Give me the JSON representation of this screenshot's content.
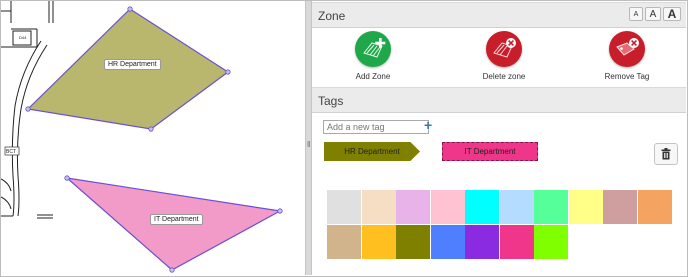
{
  "map": {
    "labels": {
      "room_code": "D44",
      "junction": "BCT"
    },
    "zones": [
      {
        "name": "HR Department",
        "color": "#b9b76e"
      },
      {
        "name": "IT Department",
        "color": "#f29ac8"
      }
    ]
  },
  "zone_section": {
    "title": "Zone",
    "font_buttons": [
      "A",
      "A",
      "A"
    ],
    "actions": [
      {
        "label": "Add Zone",
        "icon": "add-zone-icon",
        "color": "#1fa84a"
      },
      {
        "label": "Delete zone",
        "icon": "delete-zone-icon",
        "color": "#c81e2b"
      },
      {
        "label": "Remove Tag",
        "icon": "remove-tag-icon",
        "color": "#c81e2b"
      }
    ]
  },
  "tags_section": {
    "title": "Tags",
    "input_placeholder": "Add a new tag",
    "add_icon": "plus-icon",
    "tags": [
      {
        "label": "HR Department",
        "color": "#808000"
      },
      {
        "label": "IT Department",
        "color": "#f0368a"
      }
    ],
    "delete_icon": "trash-icon",
    "palette": [
      "#e0e0e0",
      "#f5dec3",
      "#e8b3e8",
      "#ffc2d2",
      "#00ffff",
      "#b3dcff",
      "#55ff99",
      "#ffff88",
      "#cf9f9f",
      "#f4a460",
      "#d2b48c",
      "#ffbf1f",
      "#808000",
      "#4f7fff",
      "#8a2be2",
      "#f0368a",
      "#7fff00"
    ]
  }
}
